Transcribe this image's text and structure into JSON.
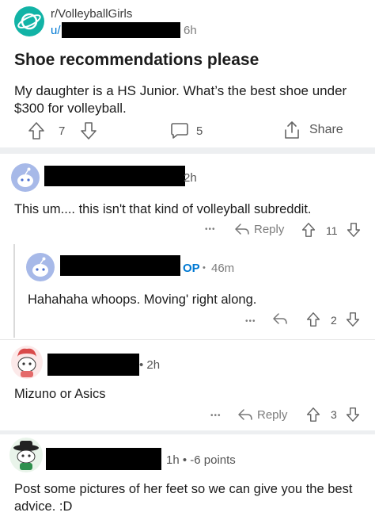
{
  "post": {
    "subreddit": "r/VolleyballGirls",
    "user_prefix": "u/",
    "age": "6h",
    "title": "Shoe recommendations please",
    "body": "My daughter is a HS Junior. What’s the best shoe under $300 for volleyball.",
    "upvotes": "7",
    "comments": "5",
    "share_label": "Share"
  },
  "comments": [
    {
      "age": "2h",
      "text": "This um.... this isn't that kind of volleyball subreddit.",
      "more": "•••",
      "reply_label": "Reply",
      "votes": "11"
    },
    {
      "badge": "OP",
      "dot": "•",
      "age": "46m",
      "text": "Hahahaha whoops. Moving' right along.",
      "more": "•••",
      "votes": "2"
    },
    {
      "age": "• 2h",
      "text": "Mizuno or Asics",
      "more": "•••",
      "reply_label": "Reply",
      "votes": "3"
    },
    {
      "age": "1h • -6 points",
      "text": "Post some pictures of her feet so we can give you the best advice. :D"
    }
  ],
  "colors": {
    "accent": "#0079d3",
    "muted": "#7c7c7c",
    "separator": "#edeff1"
  }
}
